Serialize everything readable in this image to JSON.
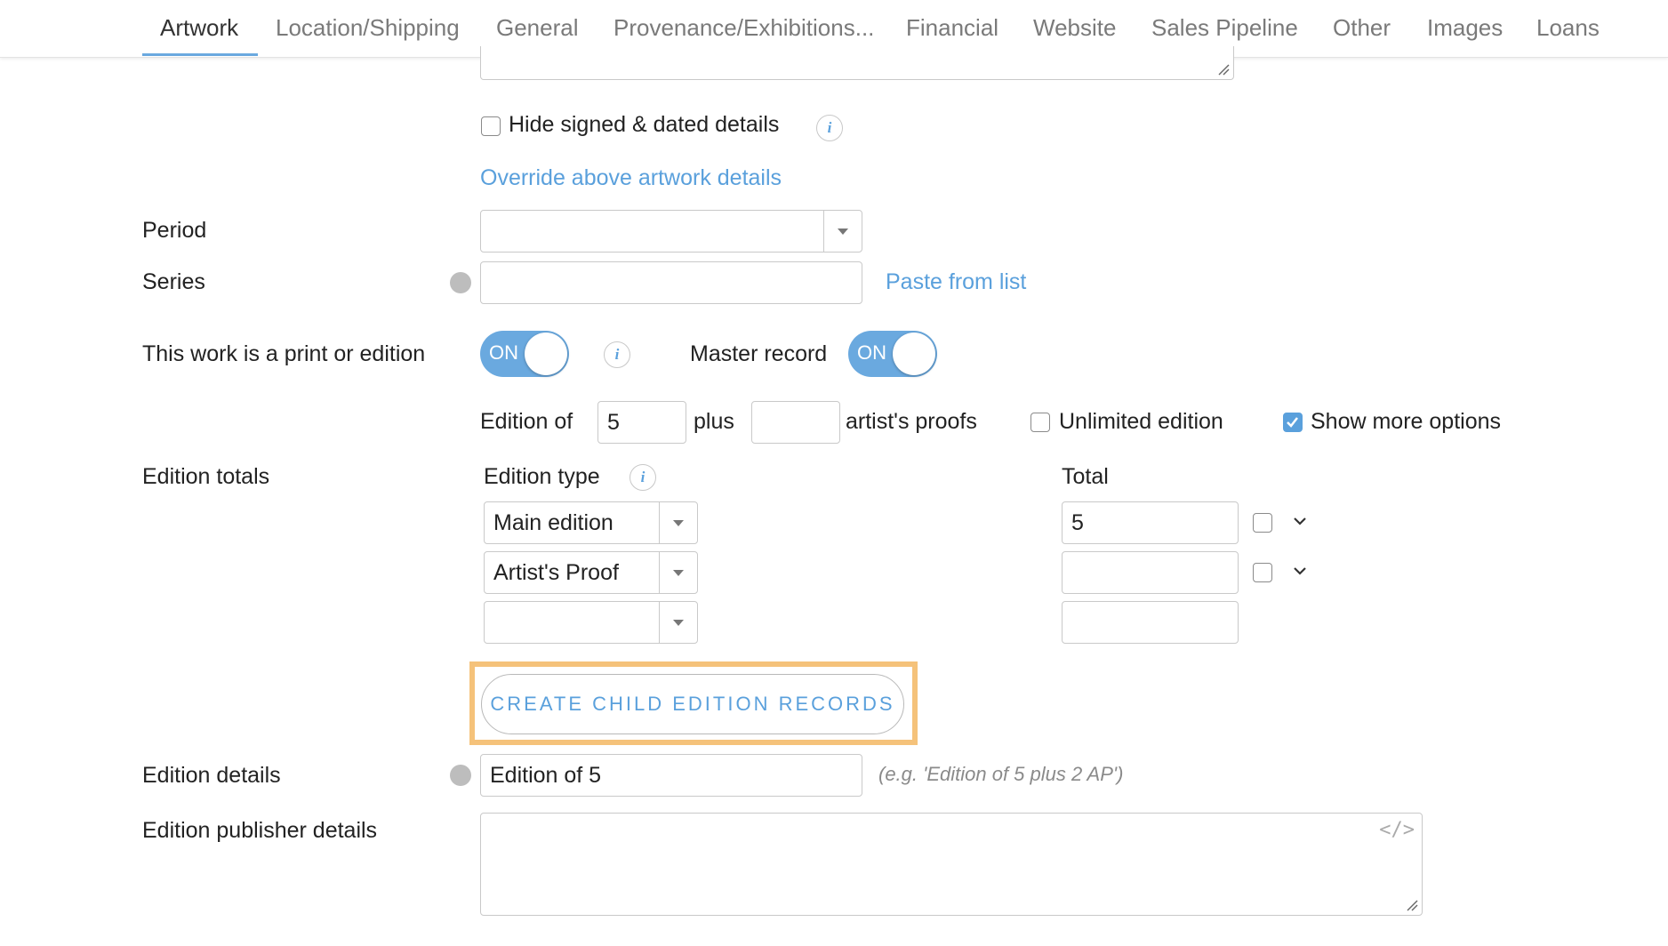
{
  "tabs": [
    {
      "label": "Artwork"
    },
    {
      "label": "Location/Shipping"
    },
    {
      "label": "General"
    },
    {
      "label": "Provenance/Exhibitions..."
    },
    {
      "label": "Financial"
    },
    {
      "label": "Website"
    },
    {
      "label": "Sales Pipeline"
    },
    {
      "label": "Other"
    },
    {
      "label": "Images"
    },
    {
      "label": "Loans"
    }
  ],
  "signed": {
    "hide_label": "Hide signed & dated details",
    "hide_checked": false,
    "override_link": "Override above artwork details"
  },
  "period": {
    "label": "Period",
    "value": ""
  },
  "series": {
    "label": "Series",
    "value": "",
    "paste_link": "Paste from list"
  },
  "print": {
    "label": "This work is a print or edition",
    "toggle_text": "ON",
    "master_label": "Master record",
    "master_toggle_text": "ON"
  },
  "edition": {
    "edition_of_label": "Edition of",
    "edition_of_value": "5",
    "plus_label": "plus",
    "proofs_value": "",
    "proofs_label": "artist's proofs",
    "unlimited_label": "Unlimited edition",
    "unlimited_checked": false,
    "more_options_label": "Show more options",
    "more_options_checked": true
  },
  "totals": {
    "label": "Edition totals",
    "type_header": "Edition type",
    "total_header": "Total",
    "rows": [
      {
        "type": "Main edition",
        "total": "5",
        "checked": false
      },
      {
        "type": "Artist's Proof",
        "total": "",
        "checked": false
      },
      {
        "type": "",
        "total": ""
      }
    ]
  },
  "create_button": "CREATE CHILD EDITION RECORDS",
  "details": {
    "label": "Edition details",
    "value": "Edition of 5",
    "hint": "(e.g. 'Edition of 5 plus 2 AP')"
  },
  "publisher": {
    "label": "Edition publisher details",
    "value": "",
    "code_icon_text": "</>"
  },
  "colors": {
    "accent": "#5aa0dc",
    "toggle": "#6aa9df",
    "highlight": "#f5c27a"
  },
  "icons": [
    "info-icon",
    "globe-icon",
    "caret-down-icon",
    "chevron-down-icon",
    "code-icon",
    "resize-icon",
    "checkmark-icon"
  ]
}
